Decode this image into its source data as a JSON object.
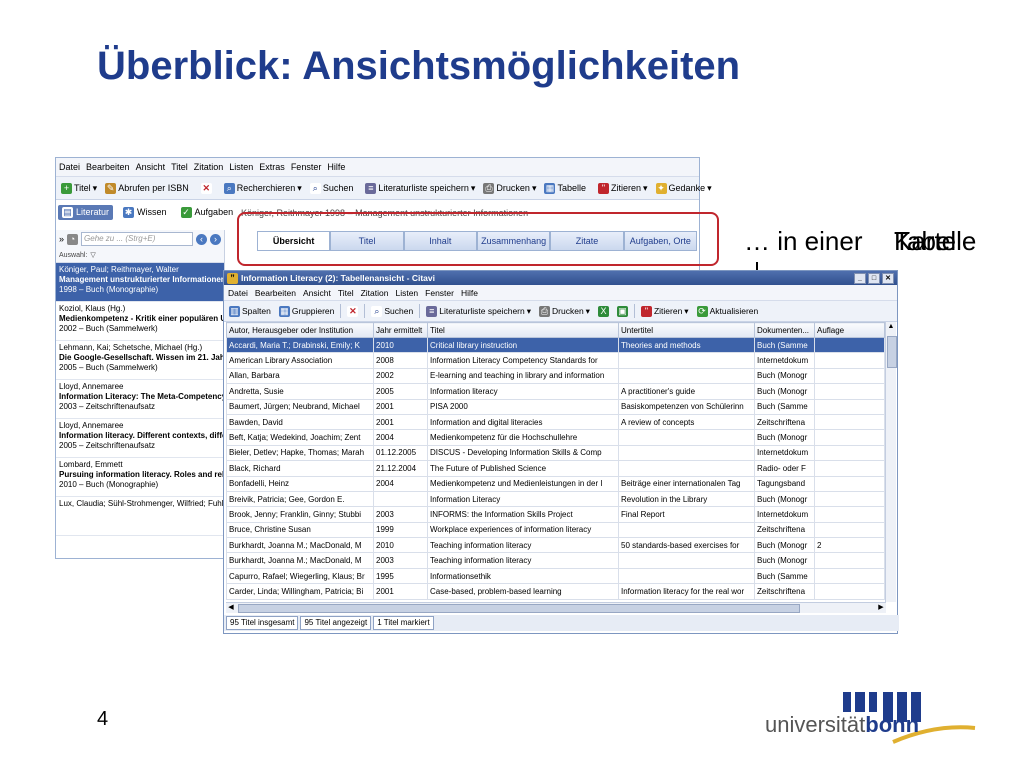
{
  "slide": {
    "title": "Überblick: Ansichtsmöglichkeiten",
    "caption_prefix": "… in einer",
    "caption_overlap": "Karte",
    "caption_overlap2": "Tabelle",
    "page_number": "4",
    "logo_text_a": "universität",
    "logo_text_b": "bonn"
  },
  "colors": {
    "title": "#1f3c8c",
    "selection": "#3d62a9",
    "highlight_box": "#c0262d"
  },
  "bg_window": {
    "menu": [
      "Datei",
      "Bearbeiten",
      "Ansicht",
      "Titel",
      "Zitation",
      "Listen",
      "Extras",
      "Fenster",
      "Hilfe"
    ],
    "toolbar": [
      "Titel",
      "Abrufen per ISBN",
      "Recherchieren",
      "Suchen",
      "Literaturliste speichern",
      "Drucken",
      "Tabelle",
      "Zitieren",
      "Gedanke"
    ],
    "nav_tabs": [
      "Literatur",
      "Wissen",
      "Aufgaben"
    ],
    "ghost_title": "Königer, Reithmayer 1998 – Management unstrukturierter Informationen",
    "search_placeholder": "Gehe zu ... (Strg+E)",
    "filter_label": "Auswahl:",
    "detail_tabs": [
      "Übersicht",
      "Titel",
      "Inhalt",
      "Zusammenhang",
      "Zitate",
      "Aufgaben, Orte"
    ],
    "sidebar_items": [
      {
        "l1": "Königer, Paul; Reithmayer, Walter",
        "l2": "Management unstrukturierter Informationen. W",
        "l3": "1998 – Buch (Monographie)"
      },
      {
        "l1": "Koziol, Klaus (Hg.)",
        "l2": "Medienkompetenz - Kritik einer populären Uni",
        "l3": "2002 – Buch (Sammelwerk)"
      },
      {
        "l1": "Lehmann, Kai; Schetsche, Michael (Hg.)",
        "l2": "Die Google-Gesellschaft. Wissen im 21. Jahrh",
        "l3": "2005 – Buch (Sammelwerk)"
      },
      {
        "l1": "Lloyd, Annemaree",
        "l2": "Information Literacy: The Meta-Competency o",
        "l3": "2003 – Zeitschriftenaufsatz"
      },
      {
        "l1": "Lloyd, Annemaree",
        "l2": "Information literacy. Different contexts, differe",
        "l3": "2005 – Zeitschriftenaufsatz"
      },
      {
        "l1": "Lombard, Emmett",
        "l2": "Pursuing information literacy. Roles and relatio",
        "l3": "2010 – Buch (Monographie)"
      },
      {
        "l1": "Lux, Claudia; Sühl-Strohmenger, Wilfried; Fuhlrot",
        "l2": "",
        "l3": ""
      }
    ]
  },
  "front_window": {
    "title": "Information Literacy (2): Tabellenansicht - Citavi",
    "menu": [
      "Datei",
      "Bearbeiten",
      "Ansicht",
      "Titel",
      "Zitation",
      "Listen",
      "Fenster",
      "Hilfe"
    ],
    "toolbar": [
      "Spalten",
      "Gruppieren",
      "Suchen",
      "Literaturliste speichern",
      "Drucken",
      "Zitieren",
      "Aktualisieren"
    ],
    "columns": [
      "Autor, Herausgeber oder Institution",
      "Jahr ermittelt",
      "Titel",
      "Untertitel",
      "Dokumenten...",
      "Auflage"
    ],
    "rows": [
      [
        "Accardi, Maria T.; Drabinski, Emily; K",
        "2010",
        "Critical library instruction",
        "Theories and methods",
        "Buch (Samme",
        ""
      ],
      [
        "American Library Association",
        "2008",
        "Information Literacy Competency Standards for",
        "",
        "Internetdokum",
        ""
      ],
      [
        "Allan, Barbara",
        "2002",
        "E-learning and teaching in library and information",
        "",
        "Buch (Monogr",
        ""
      ],
      [
        "Andretta, Susie",
        "2005",
        "Information literacy",
        "A practitioner's guide",
        "Buch (Monogr",
        ""
      ],
      [
        "Baumert, Jürgen; Neubrand, Michael",
        "2001",
        "PISA 2000",
        "Basiskompetenzen von Schülerinn",
        "Buch (Samme",
        ""
      ],
      [
        "Bawden, David",
        "2001",
        "Information and digital literacies",
        "A review of concepts",
        "Zeitschriftena",
        ""
      ],
      [
        "Beft, Katja; Wedekind, Joachim; Zent",
        "2004",
        "Medienkompetenz für die Hochschullehre",
        "",
        "Buch (Monogr",
        ""
      ],
      [
        "Bieler, Detlev; Hapke, Thomas; Marah",
        "01.12.2005",
        "DISCUS - Developing Information Skills & Comp",
        "",
        "Internetdokum",
        ""
      ],
      [
        "Black, Richard",
        "21.12.2004",
        "The Future of Published Science",
        "",
        "Radio- oder F",
        ""
      ],
      [
        "Bonfadelli, Heinz",
        "2004",
        "Medienkompetenz und Medienleistungen in der I",
        "Beiträge einer internationalen Tag",
        "Tagungsband",
        ""
      ],
      [
        "Breivik, Patricia; Gee, Gordon E.",
        "",
        "Information Literacy",
        "Revolution in the Library",
        "Buch (Monogr",
        ""
      ],
      [
        "Brook, Jenny; Franklin, Ginny; Stubbi",
        "2003",
        "INFORMS: the Information Skills Project",
        "Final Report",
        "Internetdokum",
        ""
      ],
      [
        "Bruce, Christine Susan",
        "1999",
        "Workplace experiences of information literacy",
        "",
        "Zeitschriftena",
        ""
      ],
      [
        "Burkhardt, Joanna M.; MacDonald, M",
        "2010",
        "Teaching information literacy",
        "50 standards-based exercises for",
        "Buch (Monogr",
        "2"
      ],
      [
        "Burkhardt, Joanna M.; MacDonald, M",
        "2003",
        "Teaching information literacy",
        "",
        "Buch (Monogr",
        ""
      ],
      [
        "Capurro, Rafael; Wiegerling, Klaus; Br",
        "1995",
        "Informationsethik",
        "",
        "Buch (Samme",
        ""
      ],
      [
        "Carder, Linda; Willingham, Patricia; Bi",
        "2001",
        "Case-based, problem-based learning",
        "Information literacy for the real wor",
        "Zeitschriftena",
        ""
      ]
    ],
    "status": [
      "95 Titel insgesamt",
      "95 Titel angezeigt",
      "1 Titel markiert"
    ]
  }
}
